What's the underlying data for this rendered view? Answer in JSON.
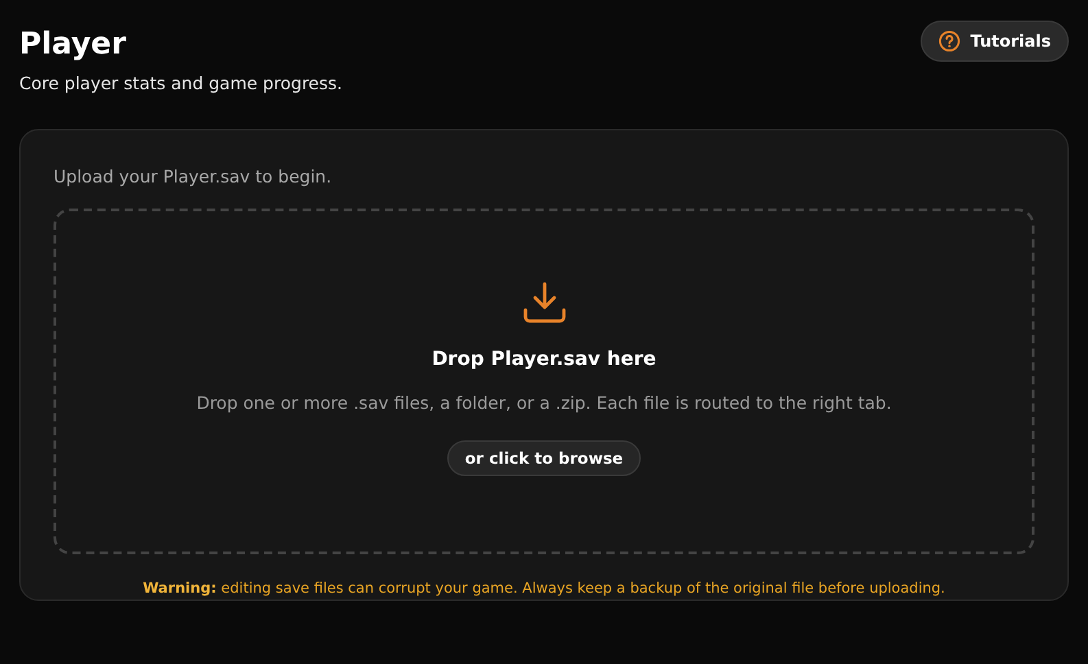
{
  "header": {
    "title": "Player",
    "subtitle": "Core player stats and game progress.",
    "tutorials_button": "Tutorials"
  },
  "upload": {
    "prompt": "Upload your Player.sav to begin.",
    "dropzone": {
      "title": "Drop Player.sav here",
      "description": "Drop one or more .sav files, a folder, or a .zip. Each file is routed to the right tab.",
      "browse_button": "or click to browse"
    },
    "warning": "**Warning:** editing save files can corrupt your game. Always keep a backup of the original file before uploading."
  }
}
